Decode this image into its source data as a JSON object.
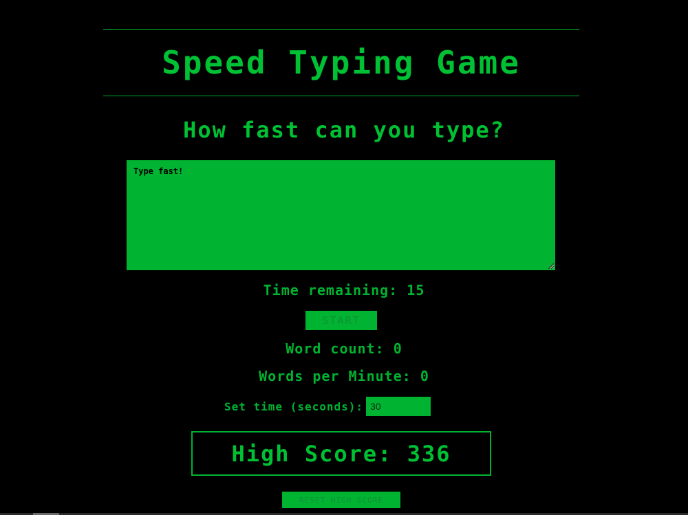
{
  "header": {
    "title": "Speed Typing Game",
    "subtitle": "How fast can you type?"
  },
  "typing_area": {
    "placeholder": "Type fast!"
  },
  "stats": {
    "time_remaining_label": "Time remaining:",
    "time_remaining_value": "15",
    "word_count_label": "Word count:",
    "word_count_value": "0",
    "wpm_label": "Words per Minute:",
    "wpm_value": "0"
  },
  "controls": {
    "start_label": "START",
    "set_time_label": "Set time (seconds):",
    "set_time_value": "30",
    "reset_label": "RESET HIGH SCORE"
  },
  "high_score": {
    "label": "High Score:",
    "value": "336"
  },
  "colors": {
    "background": "#000000",
    "accent": "#00b330",
    "dim_text": "#109038"
  }
}
